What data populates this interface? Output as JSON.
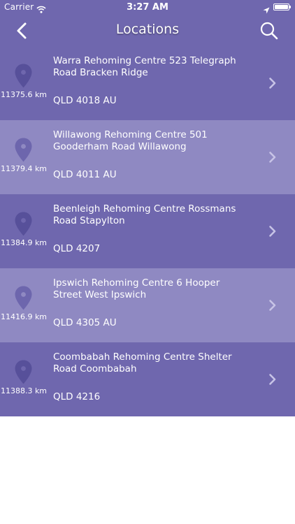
{
  "status_bar": {
    "carrier": "Carrier",
    "time": "3:27 AM",
    "battery_level": 1.0
  },
  "nav": {
    "title": "Locations",
    "back_icon": "chevron-left-icon",
    "search_icon": "search-icon"
  },
  "colors": {
    "row_dark": "#6f67ae",
    "row_light": "#8f89c2",
    "pin_dark": "#57509a",
    "pin_light": "#6d66ad",
    "chevron": "#c7c3e6"
  },
  "locations": [
    {
      "distance": "11375.6 km",
      "name": "Warra Rehoming Centre 523 Telegraph Road Bracken Ridge",
      "postcode": "QLD 4018 AU"
    },
    {
      "distance": "11379.4 km",
      "name": "Willawong Rehoming Centre 501 Gooderham Road Willawong",
      "postcode": "QLD 4011 AU"
    },
    {
      "distance": "11384.9 km",
      "name": "Beenleigh Rehoming Centre Rossmans Road Stapylton",
      "postcode": "QLD 4207"
    },
    {
      "distance": "11416.9 km",
      "name": "Ipswich Rehoming Centre 6 Hooper Street West Ipswich",
      "postcode": "QLD 4305 AU"
    },
    {
      "distance": "11388.3 km",
      "name": "Coombabah Rehoming Centre Shelter Road Coombabah",
      "postcode": "QLD 4216"
    }
  ]
}
